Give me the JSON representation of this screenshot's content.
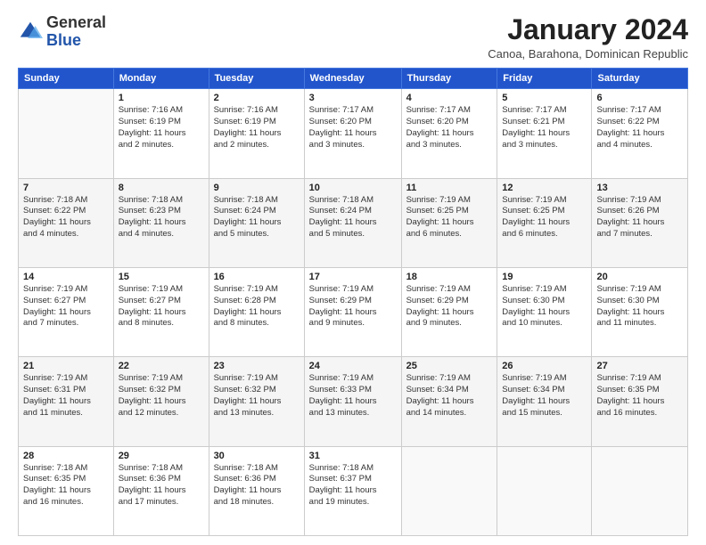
{
  "logo": {
    "general": "General",
    "blue": "Blue"
  },
  "title": "January 2024",
  "subtitle": "Canoa, Barahona, Dominican Republic",
  "days_of_week": [
    "Sunday",
    "Monday",
    "Tuesday",
    "Wednesday",
    "Thursday",
    "Friday",
    "Saturday"
  ],
  "weeks": [
    [
      {
        "day": "",
        "info": ""
      },
      {
        "day": "1",
        "info": "Sunrise: 7:16 AM\nSunset: 6:19 PM\nDaylight: 11 hours\nand 2 minutes."
      },
      {
        "day": "2",
        "info": "Sunrise: 7:16 AM\nSunset: 6:19 PM\nDaylight: 11 hours\nand 2 minutes."
      },
      {
        "day": "3",
        "info": "Sunrise: 7:17 AM\nSunset: 6:20 PM\nDaylight: 11 hours\nand 3 minutes."
      },
      {
        "day": "4",
        "info": "Sunrise: 7:17 AM\nSunset: 6:20 PM\nDaylight: 11 hours\nand 3 minutes."
      },
      {
        "day": "5",
        "info": "Sunrise: 7:17 AM\nSunset: 6:21 PM\nDaylight: 11 hours\nand 3 minutes."
      },
      {
        "day": "6",
        "info": "Sunrise: 7:17 AM\nSunset: 6:22 PM\nDaylight: 11 hours\nand 4 minutes."
      }
    ],
    [
      {
        "day": "7",
        "info": "Sunrise: 7:18 AM\nSunset: 6:22 PM\nDaylight: 11 hours\nand 4 minutes."
      },
      {
        "day": "8",
        "info": "Sunrise: 7:18 AM\nSunset: 6:23 PM\nDaylight: 11 hours\nand 4 minutes."
      },
      {
        "day": "9",
        "info": "Sunrise: 7:18 AM\nSunset: 6:24 PM\nDaylight: 11 hours\nand 5 minutes."
      },
      {
        "day": "10",
        "info": "Sunrise: 7:18 AM\nSunset: 6:24 PM\nDaylight: 11 hours\nand 5 minutes."
      },
      {
        "day": "11",
        "info": "Sunrise: 7:19 AM\nSunset: 6:25 PM\nDaylight: 11 hours\nand 6 minutes."
      },
      {
        "day": "12",
        "info": "Sunrise: 7:19 AM\nSunset: 6:25 PM\nDaylight: 11 hours\nand 6 minutes."
      },
      {
        "day": "13",
        "info": "Sunrise: 7:19 AM\nSunset: 6:26 PM\nDaylight: 11 hours\nand 7 minutes."
      }
    ],
    [
      {
        "day": "14",
        "info": "Sunrise: 7:19 AM\nSunset: 6:27 PM\nDaylight: 11 hours\nand 7 minutes."
      },
      {
        "day": "15",
        "info": "Sunrise: 7:19 AM\nSunset: 6:27 PM\nDaylight: 11 hours\nand 8 minutes."
      },
      {
        "day": "16",
        "info": "Sunrise: 7:19 AM\nSunset: 6:28 PM\nDaylight: 11 hours\nand 8 minutes."
      },
      {
        "day": "17",
        "info": "Sunrise: 7:19 AM\nSunset: 6:29 PM\nDaylight: 11 hours\nand 9 minutes."
      },
      {
        "day": "18",
        "info": "Sunrise: 7:19 AM\nSunset: 6:29 PM\nDaylight: 11 hours\nand 9 minutes."
      },
      {
        "day": "19",
        "info": "Sunrise: 7:19 AM\nSunset: 6:30 PM\nDaylight: 11 hours\nand 10 minutes."
      },
      {
        "day": "20",
        "info": "Sunrise: 7:19 AM\nSunset: 6:30 PM\nDaylight: 11 hours\nand 11 minutes."
      }
    ],
    [
      {
        "day": "21",
        "info": "Sunrise: 7:19 AM\nSunset: 6:31 PM\nDaylight: 11 hours\nand 11 minutes."
      },
      {
        "day": "22",
        "info": "Sunrise: 7:19 AM\nSunset: 6:32 PM\nDaylight: 11 hours\nand 12 minutes."
      },
      {
        "day": "23",
        "info": "Sunrise: 7:19 AM\nSunset: 6:32 PM\nDaylight: 11 hours\nand 13 minutes."
      },
      {
        "day": "24",
        "info": "Sunrise: 7:19 AM\nSunset: 6:33 PM\nDaylight: 11 hours\nand 13 minutes."
      },
      {
        "day": "25",
        "info": "Sunrise: 7:19 AM\nSunset: 6:34 PM\nDaylight: 11 hours\nand 14 minutes."
      },
      {
        "day": "26",
        "info": "Sunrise: 7:19 AM\nSunset: 6:34 PM\nDaylight: 11 hours\nand 15 minutes."
      },
      {
        "day": "27",
        "info": "Sunrise: 7:19 AM\nSunset: 6:35 PM\nDaylight: 11 hours\nand 16 minutes."
      }
    ],
    [
      {
        "day": "28",
        "info": "Sunrise: 7:18 AM\nSunset: 6:35 PM\nDaylight: 11 hours\nand 16 minutes."
      },
      {
        "day": "29",
        "info": "Sunrise: 7:18 AM\nSunset: 6:36 PM\nDaylight: 11 hours\nand 17 minutes."
      },
      {
        "day": "30",
        "info": "Sunrise: 7:18 AM\nSunset: 6:36 PM\nDaylight: 11 hours\nand 18 minutes."
      },
      {
        "day": "31",
        "info": "Sunrise: 7:18 AM\nSunset: 6:37 PM\nDaylight: 11 hours\nand 19 minutes."
      },
      {
        "day": "",
        "info": ""
      },
      {
        "day": "",
        "info": ""
      },
      {
        "day": "",
        "info": ""
      }
    ]
  ]
}
